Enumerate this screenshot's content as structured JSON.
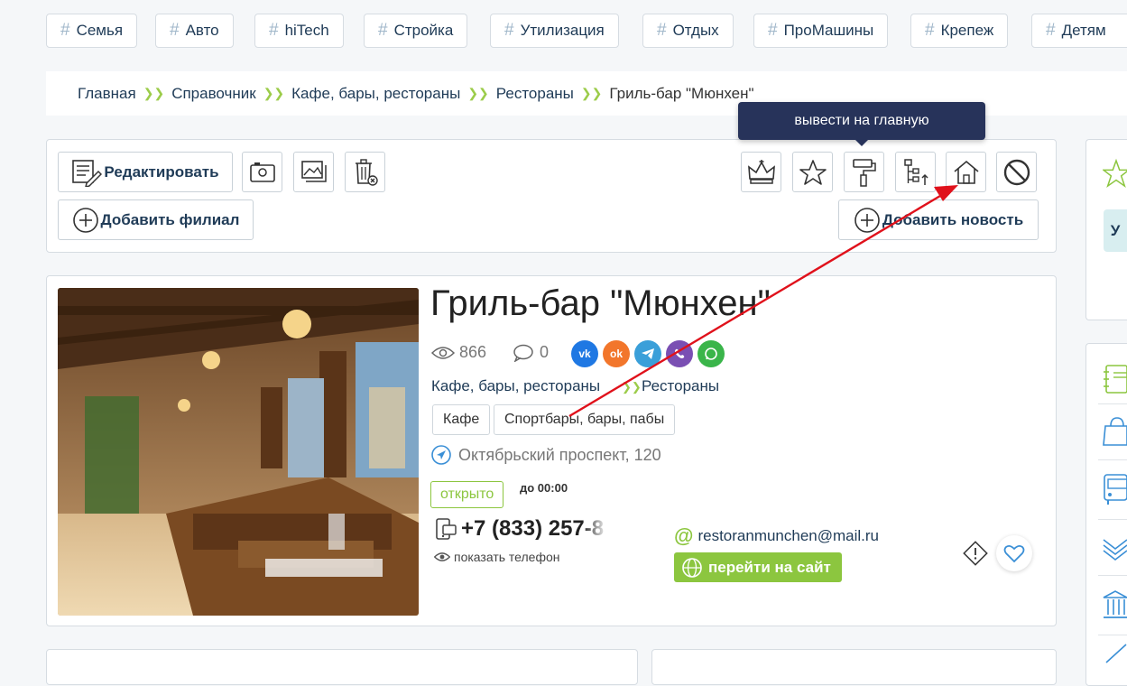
{
  "tags": [
    "Семья",
    "Авто",
    "hiTech",
    "Стройка",
    "Утилизация",
    "Отдых",
    "ПроМашины",
    "Крепеж",
    "Детям"
  ],
  "breadcrumb": [
    "Главная",
    "Справочник",
    "Кафе, бары, рестораны",
    "Рестораны",
    "Гриль-бар \"Мюнхен\""
  ],
  "tooltip": "вывести на главную",
  "toolbar": {
    "edit": "Редактировать",
    "add_branch": "Добавить филиал",
    "add_news": "Добавить новость"
  },
  "place": {
    "title": "Гриль-бар \"Мюнхен\"",
    "views": "866",
    "comments": "0",
    "social": [
      {
        "name": "vk",
        "label": "vk",
        "color": "#1f78e3"
      },
      {
        "name": "ok",
        "label": "ok",
        "color": "#f2762b"
      },
      {
        "name": "telegram",
        "label": "tg",
        "color": "#3a9fd9"
      },
      {
        "name": "viber",
        "label": "vb",
        "color": "#7a4fb3"
      },
      {
        "name": "whatsapp",
        "label": "wa",
        "color": "#3ab54a"
      }
    ],
    "category1": "Кафе, бары, рестораны",
    "category2": "Рестораны",
    "chips": [
      "Кафе",
      "Спортбары, бары, пабы"
    ],
    "address": "Октябрьский проспект, 120",
    "status": "открыто",
    "hours": "до 00:00",
    "phone": "+7 (833) 257-8",
    "show_phone": "показать телефон",
    "email": "restoranmunchen@mail.ru",
    "site": "перейти на сайт"
  },
  "right_panel": {
    "cut_text": "У"
  },
  "colors": {
    "accent_green": "#8cc63f",
    "navy": "#27335a",
    "arrow": "#e0111b"
  }
}
